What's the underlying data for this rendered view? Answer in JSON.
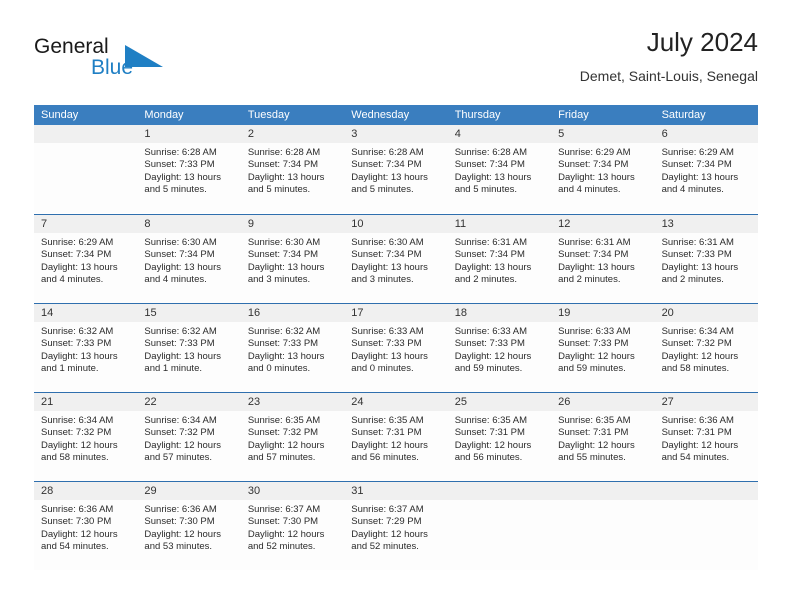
{
  "brand": {
    "name_top": "General",
    "name_bottom": "Blue",
    "accent_color": "#1f7fc4",
    "logo_icon": "triangle-flag-icon"
  },
  "header": {
    "title": "July 2024",
    "subtitle": "Demet, Saint-Louis, Senegal"
  },
  "theme": {
    "header_bg": "#3a7ebf",
    "header_text": "#ffffff",
    "row_divider": "#2f6fae",
    "daynum_bg": "#f0f0f0",
    "cell_bg": "#fdfdfd"
  },
  "weekdays": [
    "Sunday",
    "Monday",
    "Tuesday",
    "Wednesday",
    "Thursday",
    "Friday",
    "Saturday"
  ],
  "weeks": [
    [
      {
        "day": "",
        "lines": []
      },
      {
        "day": "1",
        "lines": [
          "Sunrise: 6:28 AM",
          "Sunset: 7:33 PM",
          "Daylight: 13 hours",
          "and 5 minutes."
        ]
      },
      {
        "day": "2",
        "lines": [
          "Sunrise: 6:28 AM",
          "Sunset: 7:34 PM",
          "Daylight: 13 hours",
          "and 5 minutes."
        ]
      },
      {
        "day": "3",
        "lines": [
          "Sunrise: 6:28 AM",
          "Sunset: 7:34 PM",
          "Daylight: 13 hours",
          "and 5 minutes."
        ]
      },
      {
        "day": "4",
        "lines": [
          "Sunrise: 6:28 AM",
          "Sunset: 7:34 PM",
          "Daylight: 13 hours",
          "and 5 minutes."
        ]
      },
      {
        "day": "5",
        "lines": [
          "Sunrise: 6:29 AM",
          "Sunset: 7:34 PM",
          "Daylight: 13 hours",
          "and 4 minutes."
        ]
      },
      {
        "day": "6",
        "lines": [
          "Sunrise: 6:29 AM",
          "Sunset: 7:34 PM",
          "Daylight: 13 hours",
          "and 4 minutes."
        ]
      }
    ],
    [
      {
        "day": "7",
        "lines": [
          "Sunrise: 6:29 AM",
          "Sunset: 7:34 PM",
          "Daylight: 13 hours",
          "and 4 minutes."
        ]
      },
      {
        "day": "8",
        "lines": [
          "Sunrise: 6:30 AM",
          "Sunset: 7:34 PM",
          "Daylight: 13 hours",
          "and 4 minutes."
        ]
      },
      {
        "day": "9",
        "lines": [
          "Sunrise: 6:30 AM",
          "Sunset: 7:34 PM",
          "Daylight: 13 hours",
          "and 3 minutes."
        ]
      },
      {
        "day": "10",
        "lines": [
          "Sunrise: 6:30 AM",
          "Sunset: 7:34 PM",
          "Daylight: 13 hours",
          "and 3 minutes."
        ]
      },
      {
        "day": "11",
        "lines": [
          "Sunrise: 6:31 AM",
          "Sunset: 7:34 PM",
          "Daylight: 13 hours",
          "and 2 minutes."
        ]
      },
      {
        "day": "12",
        "lines": [
          "Sunrise: 6:31 AM",
          "Sunset: 7:34 PM",
          "Daylight: 13 hours",
          "and 2 minutes."
        ]
      },
      {
        "day": "13",
        "lines": [
          "Sunrise: 6:31 AM",
          "Sunset: 7:33 PM",
          "Daylight: 13 hours",
          "and 2 minutes."
        ]
      }
    ],
    [
      {
        "day": "14",
        "lines": [
          "Sunrise: 6:32 AM",
          "Sunset: 7:33 PM",
          "Daylight: 13 hours",
          "and 1 minute."
        ]
      },
      {
        "day": "15",
        "lines": [
          "Sunrise: 6:32 AM",
          "Sunset: 7:33 PM",
          "Daylight: 13 hours",
          "and 1 minute."
        ]
      },
      {
        "day": "16",
        "lines": [
          "Sunrise: 6:32 AM",
          "Sunset: 7:33 PM",
          "Daylight: 13 hours",
          "and 0 minutes."
        ]
      },
      {
        "day": "17",
        "lines": [
          "Sunrise: 6:33 AM",
          "Sunset: 7:33 PM",
          "Daylight: 13 hours",
          "and 0 minutes."
        ]
      },
      {
        "day": "18",
        "lines": [
          "Sunrise: 6:33 AM",
          "Sunset: 7:33 PM",
          "Daylight: 12 hours",
          "and 59 minutes."
        ]
      },
      {
        "day": "19",
        "lines": [
          "Sunrise: 6:33 AM",
          "Sunset: 7:33 PM",
          "Daylight: 12 hours",
          "and 59 minutes."
        ]
      },
      {
        "day": "20",
        "lines": [
          "Sunrise: 6:34 AM",
          "Sunset: 7:32 PM",
          "Daylight: 12 hours",
          "and 58 minutes."
        ]
      }
    ],
    [
      {
        "day": "21",
        "lines": [
          "Sunrise: 6:34 AM",
          "Sunset: 7:32 PM",
          "Daylight: 12 hours",
          "and 58 minutes."
        ]
      },
      {
        "day": "22",
        "lines": [
          "Sunrise: 6:34 AM",
          "Sunset: 7:32 PM",
          "Daylight: 12 hours",
          "and 57 minutes."
        ]
      },
      {
        "day": "23",
        "lines": [
          "Sunrise: 6:35 AM",
          "Sunset: 7:32 PM",
          "Daylight: 12 hours",
          "and 57 minutes."
        ]
      },
      {
        "day": "24",
        "lines": [
          "Sunrise: 6:35 AM",
          "Sunset: 7:31 PM",
          "Daylight: 12 hours",
          "and 56 minutes."
        ]
      },
      {
        "day": "25",
        "lines": [
          "Sunrise: 6:35 AM",
          "Sunset: 7:31 PM",
          "Daylight: 12 hours",
          "and 56 minutes."
        ]
      },
      {
        "day": "26",
        "lines": [
          "Sunrise: 6:35 AM",
          "Sunset: 7:31 PM",
          "Daylight: 12 hours",
          "and 55 minutes."
        ]
      },
      {
        "day": "27",
        "lines": [
          "Sunrise: 6:36 AM",
          "Sunset: 7:31 PM",
          "Daylight: 12 hours",
          "and 54 minutes."
        ]
      }
    ],
    [
      {
        "day": "28",
        "lines": [
          "Sunrise: 6:36 AM",
          "Sunset: 7:30 PM",
          "Daylight: 12 hours",
          "and 54 minutes."
        ]
      },
      {
        "day": "29",
        "lines": [
          "Sunrise: 6:36 AM",
          "Sunset: 7:30 PM",
          "Daylight: 12 hours",
          "and 53 minutes."
        ]
      },
      {
        "day": "30",
        "lines": [
          "Sunrise: 6:37 AM",
          "Sunset: 7:30 PM",
          "Daylight: 12 hours",
          "and 52 minutes."
        ]
      },
      {
        "day": "31",
        "lines": [
          "Sunrise: 6:37 AM",
          "Sunset: 7:29 PM",
          "Daylight: 12 hours",
          "and 52 minutes."
        ]
      },
      {
        "day": "",
        "lines": []
      },
      {
        "day": "",
        "lines": []
      },
      {
        "day": "",
        "lines": []
      }
    ]
  ]
}
